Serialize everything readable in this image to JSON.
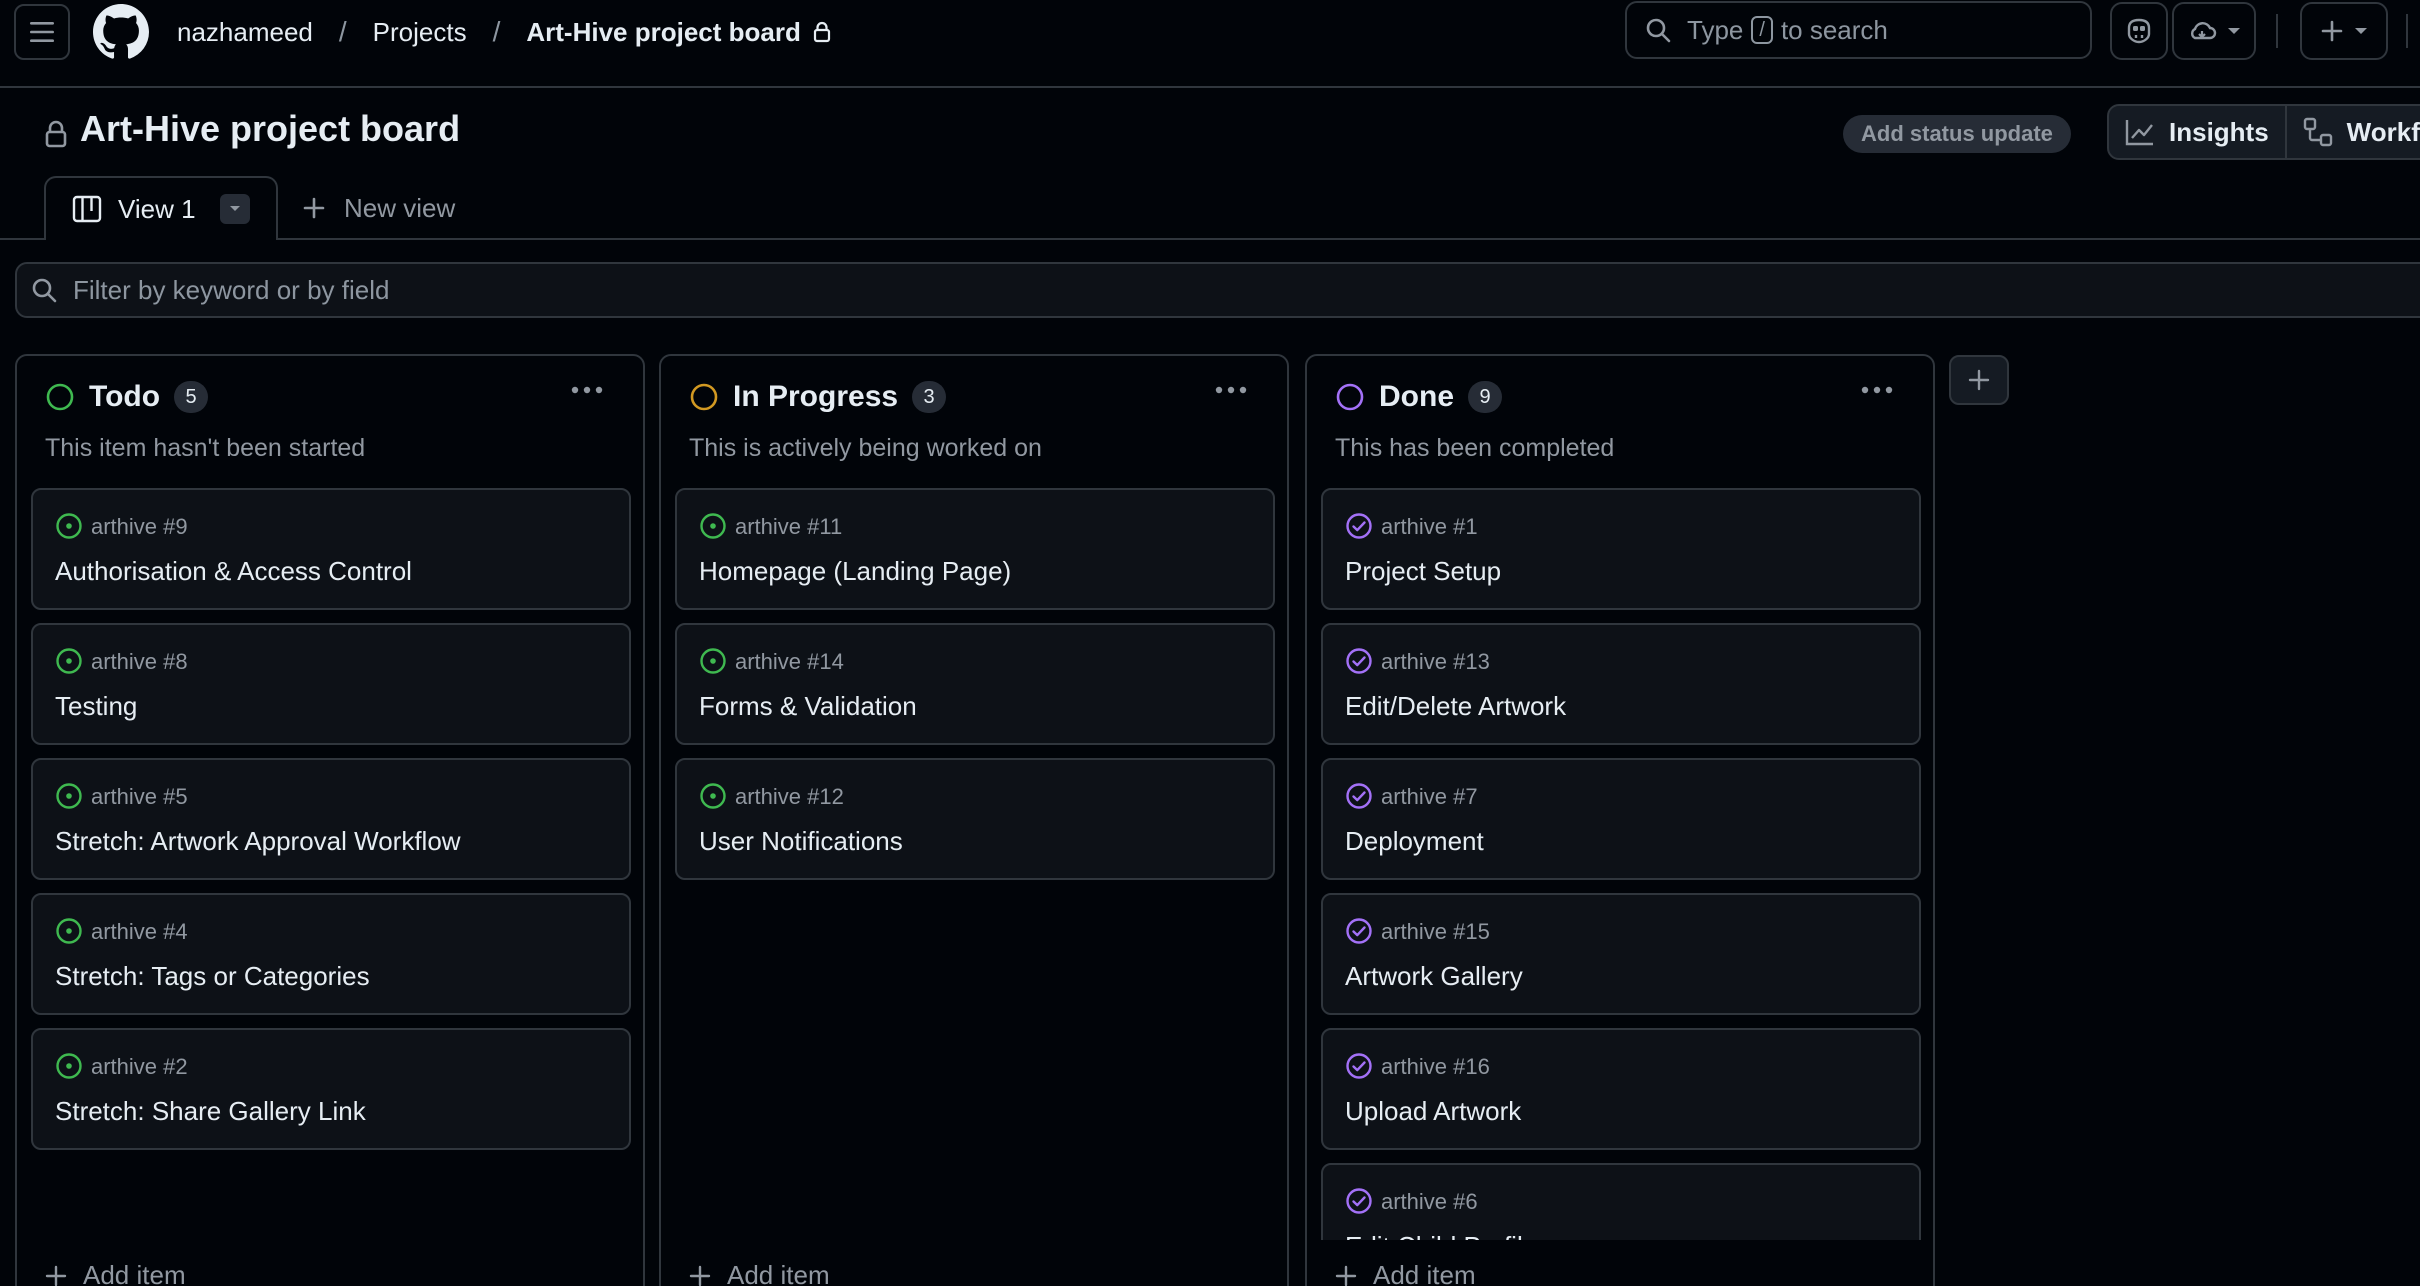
{
  "header": {
    "breadcrumbs": [
      "nazhameed",
      "Projects",
      "Art-Hive project board"
    ],
    "separator": "/",
    "search_prefix": "Type",
    "search_key": "/",
    "search_suffix": "to search"
  },
  "project": {
    "title": "Art-Hive project board",
    "status_update_label": "Add status update",
    "insights_label": "Insights",
    "workflows_label": "Workflo"
  },
  "tabs": {
    "active_label": "View 1",
    "new_view_label": "New view"
  },
  "filter": {
    "placeholder": "Filter by keyword or by field"
  },
  "columns": [
    {
      "title": "Todo",
      "count": "5",
      "description": "This item hasn't been started",
      "status_color": "#3fb950",
      "add_item_label": "Add item",
      "cards": [
        {
          "repo": "arthive #9",
          "title": "Authorisation & Access Control",
          "state": "open"
        },
        {
          "repo": "arthive #8",
          "title": "Testing",
          "state": "open"
        },
        {
          "repo": "arthive #5",
          "title": "Stretch: Artwork Approval Workflow",
          "state": "open"
        },
        {
          "repo": "arthive #4",
          "title": "Stretch: Tags or Categories",
          "state": "open"
        },
        {
          "repo": "arthive #2",
          "title": "Stretch: Share Gallery Link",
          "state": "open"
        }
      ]
    },
    {
      "title": "In Progress",
      "count": "3",
      "description": "This is actively being worked on",
      "status_color": "#d29922",
      "add_item_label": "Add item",
      "cards": [
        {
          "repo": "arthive #11",
          "title": "Homepage (Landing Page)",
          "state": "open"
        },
        {
          "repo": "arthive #14",
          "title": "Forms & Validation",
          "state": "open"
        },
        {
          "repo": "arthive #12",
          "title": "User Notifications",
          "state": "open"
        }
      ]
    },
    {
      "title": "Done",
      "count": "9",
      "description": "This has been completed",
      "status_color": "#a371f7",
      "add_item_label": "Add item",
      "cards": [
        {
          "repo": "arthive #1",
          "title": "Project Setup",
          "state": "done"
        },
        {
          "repo": "arthive #13",
          "title": "Edit/Delete Artwork",
          "state": "done"
        },
        {
          "repo": "arthive #7",
          "title": "Deployment",
          "state": "done"
        },
        {
          "repo": "arthive #15",
          "title": "Artwork Gallery",
          "state": "done"
        },
        {
          "repo": "arthive #16",
          "title": "Upload Artwork",
          "state": "done"
        },
        {
          "repo": "arthive #6",
          "title": "Edit Child Profile",
          "state": "done"
        }
      ]
    }
  ],
  "colors": {
    "background": "#010409",
    "border": "#30363d",
    "open_issue": "#3fb950",
    "closed_issue": "#a371f7",
    "in_progress": "#d29922"
  }
}
